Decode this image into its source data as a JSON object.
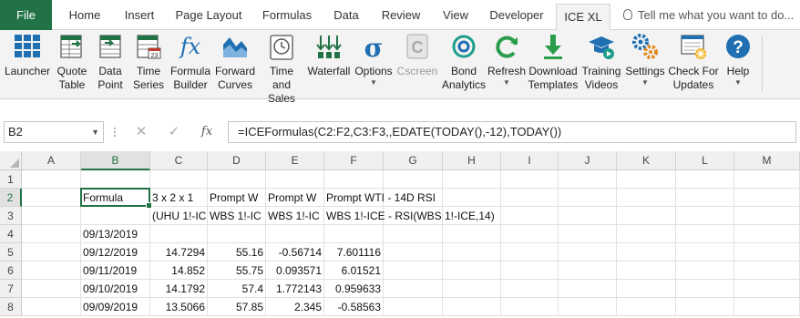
{
  "tabs": [
    {
      "label": "File"
    },
    {
      "label": "Home"
    },
    {
      "label": "Insert"
    },
    {
      "label": "Page Layout"
    },
    {
      "label": "Formulas"
    },
    {
      "label": "Data"
    },
    {
      "label": "Review"
    },
    {
      "label": "View"
    },
    {
      "label": "Developer"
    },
    {
      "label": "ICE XL"
    }
  ],
  "active_tab": "ICE XL",
  "tell_me": "Tell me what you want to do...",
  "ribbon": {
    "buttons": [
      {
        "line1": "Launcher",
        "line2": "",
        "icon": "launcher-grid-icon"
      },
      {
        "line1": "Quote",
        "line2": "Table",
        "icon": "quote-table-icon"
      },
      {
        "line1": "Data",
        "line2": "Point",
        "icon": "data-point-icon"
      },
      {
        "line1": "Time",
        "line2": "Series",
        "icon": "time-series-icon"
      },
      {
        "line1": "Formula",
        "line2": "Builder",
        "icon": "fx-icon"
      },
      {
        "line1": "Forward",
        "line2": "Curves",
        "icon": "forward-curves-icon"
      },
      {
        "line1": "Time",
        "line2": "and Sales",
        "icon": "clock-icon"
      },
      {
        "line1": "Waterfall",
        "line2": "",
        "icon": "waterfall-icon"
      },
      {
        "line1": "Options",
        "line2": "",
        "icon": "sigma-icon"
      },
      {
        "line1": "Cscreen",
        "line2": "",
        "icon": "cscreen-icon"
      },
      {
        "line1": "Bond",
        "line2": "Analytics",
        "icon": "bond-analytics-icon"
      },
      {
        "line1": "Refresh",
        "line2": "",
        "icon": "refresh-icon"
      },
      {
        "line1": "Download",
        "line2": "Templates",
        "icon": "download-icon"
      },
      {
        "line1": "Training",
        "line2": "Videos",
        "icon": "graduation-cap-icon"
      },
      {
        "line1": "Settings",
        "line2": "",
        "icon": "gears-icon"
      },
      {
        "line1": "Check For",
        "line2": "Updates",
        "icon": "updates-icon"
      },
      {
        "line1": "Help",
        "line2": "",
        "icon": "help-icon"
      }
    ],
    "colors": {
      "green": "#217346",
      "blue": "#1f6fb2",
      "teal": "#1e9e8e"
    }
  },
  "formula_bar": {
    "name_box": "B2",
    "cancel_glyph": "✕",
    "enter_glyph": "✓",
    "fx_glyph": "fx",
    "formula": "=ICEFormulas(C2:F2,C3:F3,,EDATE(TODAY(),-12),TODAY())"
  },
  "grid": {
    "columns": [
      "A",
      "B",
      "C",
      "D",
      "E",
      "F",
      "G",
      "H",
      "I",
      "J",
      "K",
      "L",
      "M"
    ],
    "rows": [
      "1",
      "2",
      "3",
      "4",
      "5",
      "6",
      "7",
      "8"
    ],
    "selected_column": "B",
    "selected_row": "2",
    "cells": {
      "B2": "Formula",
      "C2": "3 x 2 x 1",
      "D2": "Prompt W",
      "E2": "Prompt W",
      "F2": "Prompt WTI - 14D RSI",
      "C3": "(UHU 1!-IC",
      "D3": "WBS 1!-IC",
      "E3": "WBS 1!-IC",
      "F3": "WBS 1!-ICE - RSI(WBS 1!-ICE,14)",
      "B4": "09/13/2019",
      "B5": "09/12/2019",
      "C5": "14.7294",
      "D5": "55.16",
      "E5": "-0.56714",
      "F5": "7.601116",
      "B6": "09/11/2019",
      "C6": "14.852",
      "D6": "55.75",
      "E6": "0.093571",
      "F6": "6.01521",
      "B7": "09/10/2019",
      "C7": "14.1792",
      "D7": "57.4",
      "E7": "1.772143",
      "F7": "0.959633",
      "B8": "09/09/2019",
      "C8": "13.5066",
      "D8": "57.85",
      "E8": "2.345",
      "F8": "-0.58563"
    }
  }
}
